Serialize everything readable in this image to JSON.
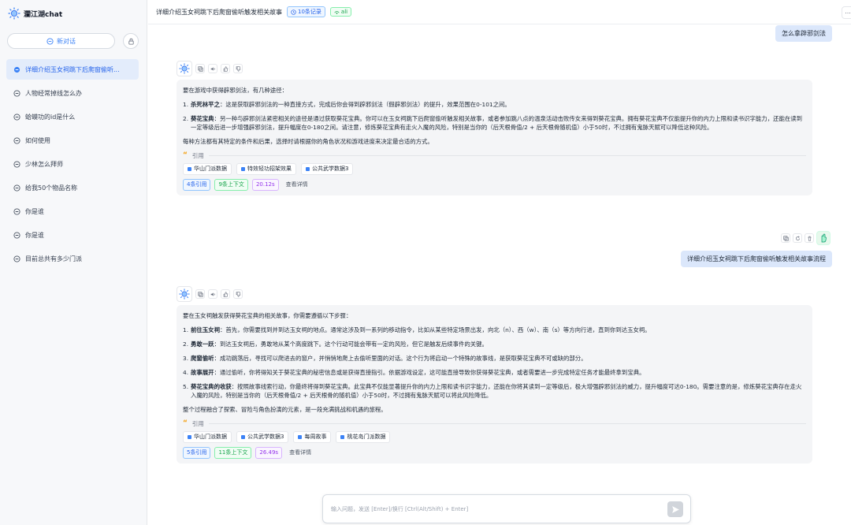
{
  "app": {
    "name": "瀾江湖chat"
  },
  "sidebar": {
    "new_chat_label": "新对话",
    "items": [
      {
        "label": "详细介绍玉女祠跳下后爬窗偷听...",
        "active": true
      },
      {
        "label": "人物经常掉线怎么办"
      },
      {
        "label": "蛤蟆功的id是什么"
      },
      {
        "label": "如何使用"
      },
      {
        "label": "少林怎么拜师"
      },
      {
        "label": "给我50个物品名称"
      },
      {
        "label": "你是谁"
      },
      {
        "label": "你是谁"
      },
      {
        "label": "目前总共有多少门派"
      }
    ]
  },
  "header": {
    "title": "详细介绍玉女祠跳下后爬窗偷听触发相关故事",
    "records_badge": "10条记录",
    "model_badge": "ali",
    "more": "..."
  },
  "messages": {
    "user1": "怎么拿辟邪剑法",
    "ai1": {
      "intro": "要在游戏中获得辟邪剑法，有几种途径：",
      "items": [
        {
          "num": "1.",
          "title": "杀死林平之",
          "text": "：这是获取辟邪剑法的一种直接方式，完成后你会得到辟邪剑法（假辟邪剑法）的提升，效果范围在0-101之间。"
        },
        {
          "num": "2.",
          "title": "葵花宝典",
          "text": "：另一种与辟邪剑法紧密相关的途径是通过获取葵花宝典。你可以在玉女祠跳下后爬窗偷听触发相关故事，或者参加跳八点的温泉活动击败传女来得到葵花宝典。拥有葵花宝典不仅能提升你的内力上限和读书识字能力，还能在读到一定等级后进一步增强辟邪剑法，提升幅度在0-180之间。请注意，修炼葵花宝典有走火入魔的风险，特别是当你的（后天根骨值/2 + 后天根骨随机值）小于50时，不过拥有鬼脉天赋可以降低这种风险。"
        }
      ],
      "outro": "每种方法都有其特定的条件和后果，选择时请根据你的角色状况和游戏进度来决定最合适的方式。",
      "quote_label": "引用",
      "citations": [
        "华山门派数据",
        "特效轻功招架效果",
        "公共武学数据3"
      ],
      "stats": {
        "refs": "4条引用",
        "context": "9条上下文",
        "time": "20.12s",
        "detail": "查看详情"
      }
    },
    "user2": "详细介绍玉女祠跳下后爬窗偷听触发相关故事流程",
    "ai2": {
      "intro": "要在玉女祠触发获得葵花宝典的相关故事，你需要遵循以下步骤：",
      "items": [
        {
          "num": "1.",
          "title": "前往玉女祠",
          "text": "：首先，你需要找到并到达玉女祠的地点。通常这涉及到一系列的移动指令，比如从某些特定场景出发，向北（n）、西（w）、南（s）等方向行进，直到你到达玉女祠。"
        },
        {
          "num": "2.",
          "title": "勇敢一跃",
          "text": "：到达玉女祠后，勇敢地从某个高度跳下。这个行动可能会带有一定的风险，但它是触发后续事件的关键。"
        },
        {
          "num": "3.",
          "title": "爬窗偷听",
          "text": "：成功跳落后，寻找可以爬进去的窗户，并悄悄地爬上去偷听里面的对话。这个行为将启动一个特殊的故事线，是获取葵花宝典不可或缺的部分。"
        },
        {
          "num": "4.",
          "title": "故事展开",
          "text": "：通过偷听，你将得知关于葵花宝典的秘密信息或是获得直接指引。依据游戏设定，这可能直接导致你获得葵花宝典，或者需要进一步完成特定任务才能最终拿到宝典。"
        },
        {
          "num": "5.",
          "title": "葵花宝典的收获",
          "text": "：按照故事线索行动，你最终将得到葵花宝典。此宝典不仅能显著提升你的内力上限和读书识字能力，还能在你将其读到一定等级后，极大增强辟邪剑法的威力，提升幅度可达0-180。需要注意的是，修炼葵花宝典存在走火入魔的风险，特别是当你的（后天根骨值/2 + 后天根骨的随机值）小于50时，不过拥有鬼脉天赋可以将此风险降低。"
        }
      ],
      "outro": "整个过程融合了探索、冒险与角色扮演的元素，是一段充满挑战和机遇的旅程。",
      "quote_label": "引用",
      "citations": [
        "华山门派数据",
        "公共武学数据3",
        "每周故事",
        "桃花岛门派数据"
      ],
      "stats": {
        "refs": "5条引用",
        "context": "11条上下文",
        "time": "26.49s",
        "detail": "查看详情"
      }
    }
  },
  "input": {
    "placeholder": "输入问题，发送 [Enter]/换行 [Ctrl(Alt/Shift) + Enter]"
  },
  "colors": {
    "accent": "#3b82f6",
    "sidebar_bg": "#f7f8fa",
    "user_bubble": "#dbe7fb",
    "ai_bubble": "#f4f5f7"
  }
}
